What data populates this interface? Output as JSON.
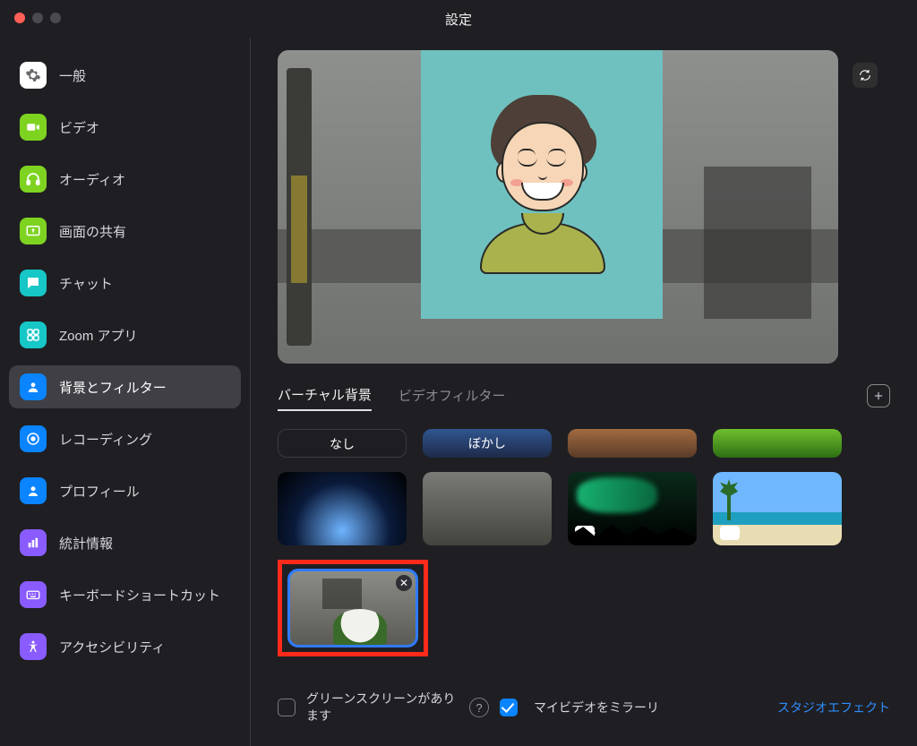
{
  "title": "設定",
  "sidebar": {
    "items": [
      {
        "label": "一般"
      },
      {
        "label": "ビデオ"
      },
      {
        "label": "オーディオ"
      },
      {
        "label": "画面の共有"
      },
      {
        "label": "チャット"
      },
      {
        "label": "Zoom アプリ"
      },
      {
        "label": "背景とフィルター"
      },
      {
        "label": "レコーディング"
      },
      {
        "label": "プロフィール"
      },
      {
        "label": "統計情報"
      },
      {
        "label": "キーボードショートカット"
      },
      {
        "label": "アクセシビリティ"
      }
    ],
    "active_index": 6
  },
  "tabs": {
    "virtual_background": "バーチャル背景",
    "video_filters": "ビデオフィルター"
  },
  "thumbs": {
    "none": "なし",
    "blur": "ぼかし"
  },
  "footer": {
    "greenscreen": "グリーンスクリーンがあります",
    "mirror": "マイビデオをミラーリ",
    "studio": "スタジオエフェクト"
  }
}
